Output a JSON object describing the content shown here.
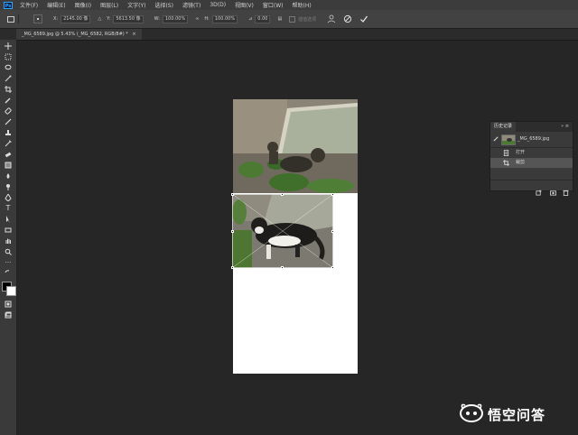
{
  "menubar": {
    "logo": "Ps",
    "items": [
      "文件(F)",
      "编辑(E)",
      "图像(I)",
      "图层(L)",
      "文字(Y)",
      "选择(S)",
      "滤镜(T)",
      "3D(D)",
      "视图(V)",
      "窗口(W)",
      "帮助(H)"
    ]
  },
  "options": {
    "x_label": "X:",
    "x_value": "2145.00 像",
    "y_label": "Y:",
    "y_value": "5613.50 像",
    "w_label": "W:",
    "w_value": "100.00%",
    "h_label": "H:",
    "h_value": "100.00%",
    "angle_label": "⊿",
    "angle_value": "0.00",
    "interp_label": "插值选项"
  },
  "document_tab": {
    "title": "_MG_6589.jpg @ 5.43% (_MG_6582, RGB/8#) *",
    "close": "×"
  },
  "history_panel": {
    "title": "历史记录",
    "snapshot_name": "_MG_6589.jpg",
    "steps": [
      {
        "label": "打开",
        "icon": "document-icon",
        "active": false
      },
      {
        "label": "裁剪",
        "icon": "crop-icon",
        "active": true
      }
    ]
  },
  "watermark": {
    "text": "悟空问答"
  },
  "colors": {
    "accent": "#31a8ff",
    "panel": "#3a3a3a",
    "workspace": "#262626"
  }
}
